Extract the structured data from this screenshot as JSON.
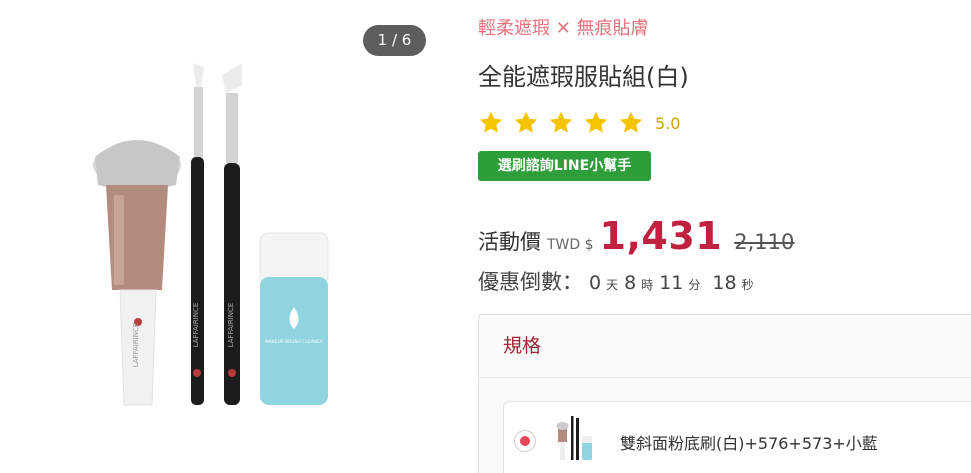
{
  "gallery": {
    "pager": "1 / 6",
    "image_name": "product-image",
    "brush_text": "LAFFAIRINCE",
    "bottle_text": "MAKEUP BRUSH CLEANER"
  },
  "product": {
    "tagline": "輕柔遮瑕 ✕ 無痕貼膚",
    "title": "全能遮瑕服貼組(白)",
    "rating": {
      "stars": 5,
      "value": "5.0",
      "star_color": "#f5c400"
    },
    "line_button": "選刷諮詢LINE小幫手",
    "price": {
      "label": "活動價",
      "currency": "TWD $",
      "value": "1,431",
      "original": "2,110",
      "price_color": "#c0213f"
    },
    "countdown": {
      "label": "優惠倒數：",
      "days": "0",
      "days_unit": "天",
      "hours": "8",
      "hours_unit": "時",
      "minutes": "11",
      "minutes_unit": "分",
      "seconds": "18",
      "seconds_unit": "秒"
    }
  },
  "spec": {
    "header": "規格",
    "options": [
      {
        "label": "雙斜面粉底刷(白)+576+573+小藍",
        "selected": true
      }
    ]
  }
}
